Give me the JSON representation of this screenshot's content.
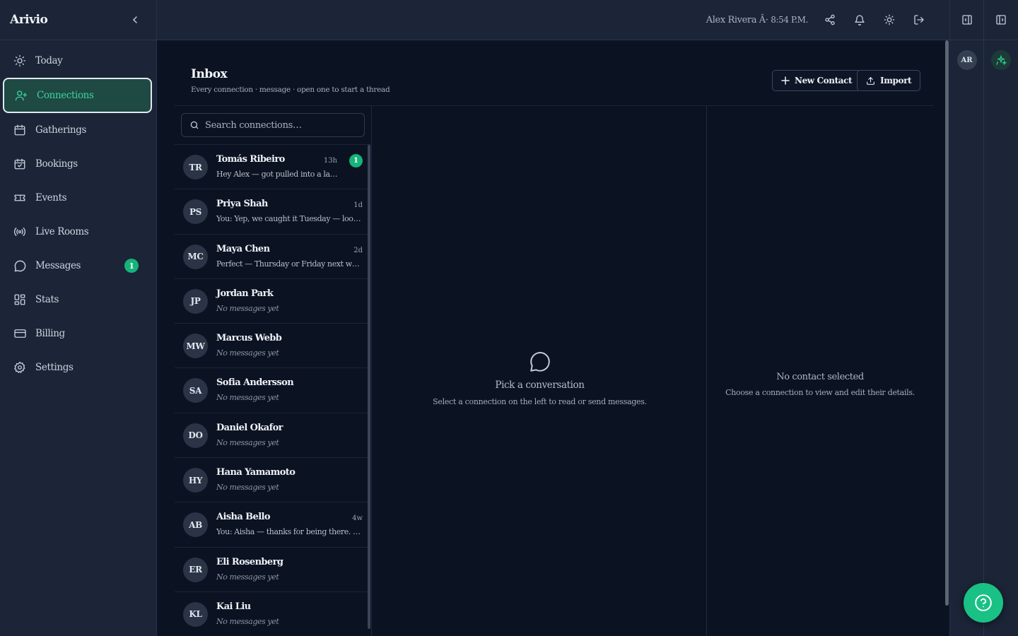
{
  "brand": "Arivio",
  "sidebar": {
    "items": [
      {
        "label": "Today",
        "icon": "sun-icon"
      },
      {
        "label": "Connections",
        "icon": "user-plus-icon",
        "active": true
      },
      {
        "label": "Gatherings",
        "icon": "calendar-icon"
      },
      {
        "label": "Bookings",
        "icon": "calendar-check-icon"
      },
      {
        "label": "Events",
        "icon": "ticket-icon"
      },
      {
        "label": "Live Rooms",
        "icon": "broadcast-icon"
      },
      {
        "label": "Messages",
        "icon": "message-circle-icon",
        "badge": "1"
      },
      {
        "label": "Stats",
        "icon": "dashboard-grid-icon"
      },
      {
        "label": "Billing",
        "icon": "credit-card-icon"
      },
      {
        "label": "Settings",
        "icon": "gear-icon"
      }
    ]
  },
  "topbar": {
    "user": "Alex Rivera",
    "separator": "Â·",
    "time": "8:54 P.M."
  },
  "rail": {
    "user_initials": "AR"
  },
  "page": {
    "title": "Inbox",
    "subtitle": "Every connection · message · open one to start a thread",
    "new_contact_label": "New Contact",
    "import_label": "Import"
  },
  "search": {
    "placeholder": "Search connections…",
    "value": ""
  },
  "contacts": [
    {
      "initials": "TR",
      "name": "Tomás Ribeiro",
      "time": "13h",
      "preview": "Hey Alex — got pulled into a la…",
      "badge": "1",
      "empty": false
    },
    {
      "initials": "PS",
      "name": "Priya Shah",
      "time": "1d",
      "preview": "You: Yep, we caught it Tuesday — look…",
      "badge": "",
      "empty": false
    },
    {
      "initials": "MC",
      "name": "Maya Chen",
      "time": "2d",
      "preview": "Perfect — Thursday or Friday next wee…",
      "badge": "",
      "empty": false
    },
    {
      "initials": "JP",
      "name": "Jordan Park",
      "time": "",
      "preview": "No messages yet",
      "badge": "",
      "empty": true
    },
    {
      "initials": "MW",
      "name": "Marcus Webb",
      "time": "",
      "preview": "No messages yet",
      "badge": "",
      "empty": true
    },
    {
      "initials": "SA",
      "name": "Sofia Andersson",
      "time": "",
      "preview": "No messages yet",
      "badge": "",
      "empty": true
    },
    {
      "initials": "DO",
      "name": "Daniel Okafor",
      "time": "",
      "preview": "No messages yet",
      "badge": "",
      "empty": true
    },
    {
      "initials": "HY",
      "name": "Hana Yamamoto",
      "time": "",
      "preview": "No messages yet",
      "badge": "",
      "empty": true
    },
    {
      "initials": "AB",
      "name": "Aisha Bello",
      "time": "4w",
      "preview": "You: Aisha — thanks for being there. Ta…",
      "badge": "",
      "empty": false
    },
    {
      "initials": "ER",
      "name": "Eli Rosenberg",
      "time": "",
      "preview": "No messages yet",
      "badge": "",
      "empty": true
    },
    {
      "initials": "KL",
      "name": "Kai Liu",
      "time": "",
      "preview": "No messages yet",
      "badge": "",
      "empty": true
    }
  ],
  "conversation": {
    "empty_title": "Pick a conversation",
    "empty_sub": "Select a connection on the left to read or send messages."
  },
  "details": {
    "empty_title": "No contact selected",
    "empty_sub": "Choose a connection to view and edit their details."
  },
  "colors": {
    "accent": "#19c185",
    "active_bg": "#1e4a43",
    "sidebar_bg": "#1b2537",
    "main_bg": "#0b1322"
  }
}
